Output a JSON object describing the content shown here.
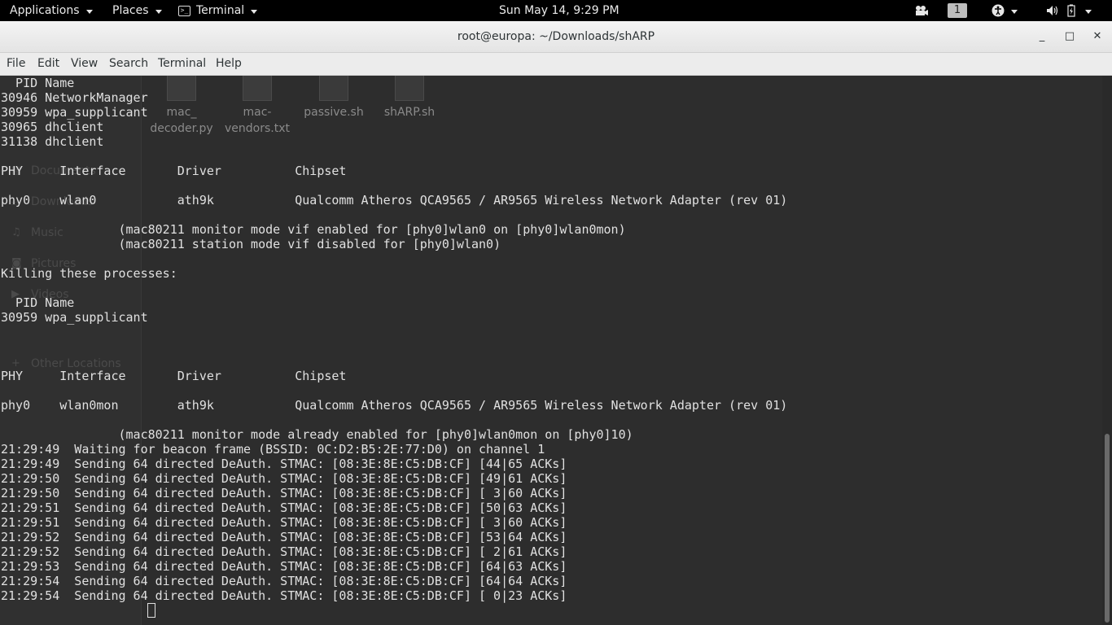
{
  "topbar": {
    "applications": "Applications",
    "places": "Places",
    "terminal": "Terminal",
    "clock": "Sun May 14,  9:29 PM",
    "workspace": "1"
  },
  "window": {
    "title": "root@europa: ~/Downloads/shARP",
    "minimize": "_",
    "maximize": "□",
    "close": "✕"
  },
  "menu": [
    "File",
    "Edit",
    "View",
    "Search",
    "Terminal",
    "Help"
  ],
  "background_files": [
    {
      "name": "mac_\ndecoder.py"
    },
    {
      "name": "mac-\nvendors.txt"
    },
    {
      "name": "passive.sh"
    },
    {
      "name": "shARP.sh"
    }
  ],
  "background_sidebar": [
    {
      "label": "Documents",
      "icon": "doc-icon"
    },
    {
      "label": "Downloads",
      "icon": "download-icon"
    },
    {
      "label": "Music",
      "icon": "music-icon"
    },
    {
      "label": "Pictures",
      "icon": "camera-icon"
    },
    {
      "label": "Videos",
      "icon": "video-icon"
    },
    {
      "label": "Other Locations",
      "icon": "plus-icon"
    }
  ],
  "terminal_lines": [
    "  PID Name",
    "30946 NetworkManager",
    "30959 wpa_supplicant",
    "30965 dhclient",
    "31138 dhclient",
    "",
    "PHY\tInterface\tDriver\t\tChipset",
    "",
    "phy0\twlan0\t\tath9k\t\tQualcomm Atheros QCA9565 / AR9565 Wireless Network Adapter (rev 01)",
    "",
    "\t\t(mac80211 monitor mode vif enabled for [phy0]wlan0 on [phy0]wlan0mon)",
    "\t\t(mac80211 station mode vif disabled for [phy0]wlan0)",
    "",
    "Killing these processes:",
    "",
    "  PID Name",
    "30959 wpa_supplicant",
    "",
    "",
    "",
    "PHY\tInterface\tDriver\t\tChipset",
    "",
    "phy0\twlan0mon\tath9k\t\tQualcomm Atheros QCA9565 / AR9565 Wireless Network Adapter (rev 01)",
    "",
    "\t\t(mac80211 monitor mode already enabled for [phy0]wlan0mon on [phy0]10)",
    "21:29:49  Waiting for beacon frame (BSSID: 0C:D2:B5:2E:77:D0) on channel 1",
    "21:29:49  Sending 64 directed DeAuth. STMAC: [08:3E:8E:C5:DB:CF] [44|65 ACKs]",
    "21:29:50  Sending 64 directed DeAuth. STMAC: [08:3E:8E:C5:DB:CF] [49|61 ACKs]",
    "21:29:50  Sending 64 directed DeAuth. STMAC: [08:3E:8E:C5:DB:CF] [ 3|60 ACKs]",
    "21:29:51  Sending 64 directed DeAuth. STMAC: [08:3E:8E:C5:DB:CF] [50|63 ACKs]",
    "21:29:51  Sending 64 directed DeAuth. STMAC: [08:3E:8E:C5:DB:CF] [ 3|60 ACKs]",
    "21:29:52  Sending 64 directed DeAuth. STMAC: [08:3E:8E:C5:DB:CF] [53|64 ACKs]",
    "21:29:52  Sending 64 directed DeAuth. STMAC: [08:3E:8E:C5:DB:CF] [ 2|61 ACKs]",
    "21:29:53  Sending 64 directed DeAuth. STMAC: [08:3E:8E:C5:DB:CF] [64|63 ACKs]",
    "21:29:54  Sending 64 directed DeAuth. STMAC: [08:3E:8E:C5:DB:CF] [64|64 ACKs]",
    "21:29:54  Sending 64 directed DeAuth. STMAC: [08:3E:8E:C5:DB:CF] [ 0|23 ACKs]"
  ],
  "colors": {
    "terminal_bg": "#2d2d2d",
    "terminal_fg": "#e0e0e0",
    "topbar_bg": "#000000"
  }
}
